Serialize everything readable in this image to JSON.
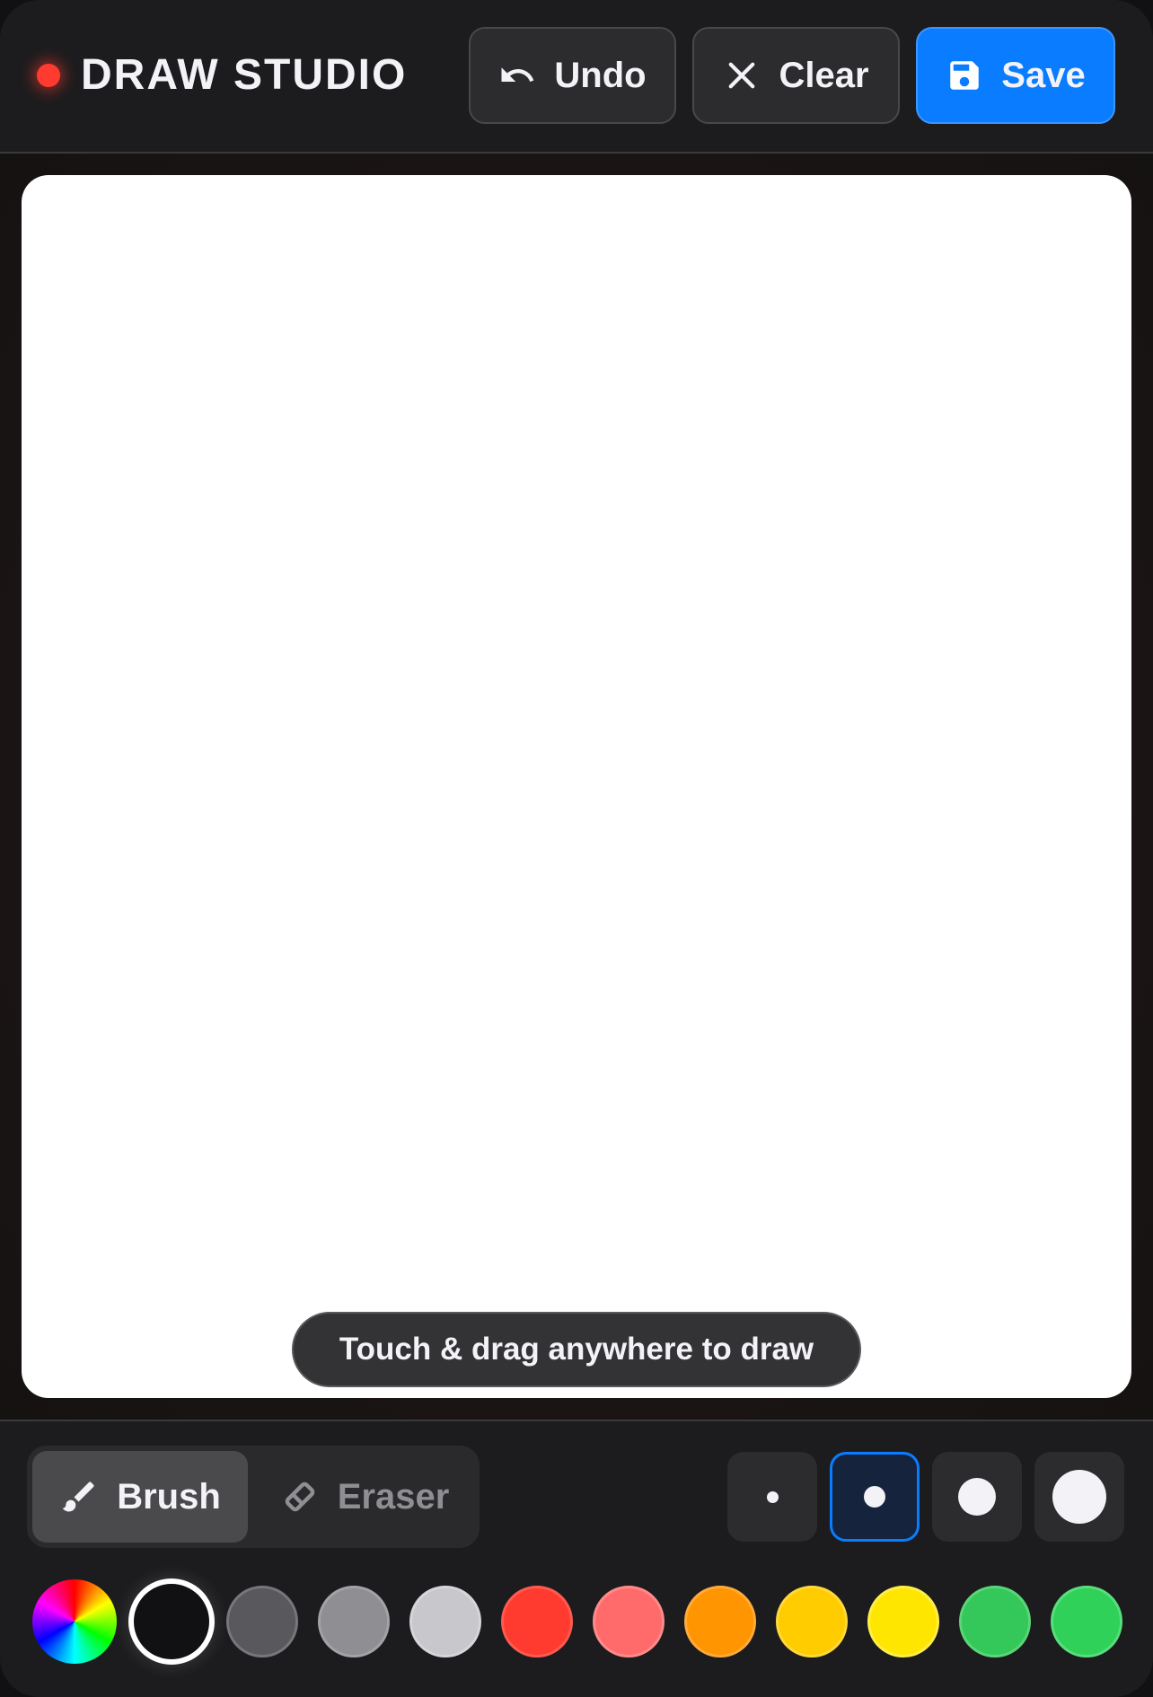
{
  "header": {
    "title": "DRAW STUDIO",
    "undo_label": "Undo",
    "clear_label": "Clear",
    "save_label": "Save",
    "undo_icon": "undo-arrow-icon",
    "clear_icon": "x-icon",
    "save_icon": "floppy-disk-icon"
  },
  "canvas": {
    "hint": "Touch & drag anywhere to draw",
    "background": "#ffffff"
  },
  "tools": {
    "brush_label": "Brush",
    "eraser_label": "Eraser",
    "active_tool": "Brush",
    "brush_icon": "paintbrush-icon",
    "eraser_icon": "eraser-icon"
  },
  "brush_sizes": {
    "options": [
      "xs",
      "s",
      "m",
      "l"
    ],
    "selected": "s"
  },
  "palette": {
    "custom_picker_icon": "color-wheel-icon",
    "selected_color": "#111113",
    "colors": [
      "#111113",
      "#58585d",
      "#8e8e93",
      "#c7c7cc",
      "#ff3b30",
      "#ff6b6b",
      "#ff9500",
      "#ffcc00",
      "#ffe600",
      "#34c759",
      "#30d158"
    ]
  },
  "theme": {
    "accent": "#0a7cff",
    "record_dot": "#ff3b30"
  }
}
